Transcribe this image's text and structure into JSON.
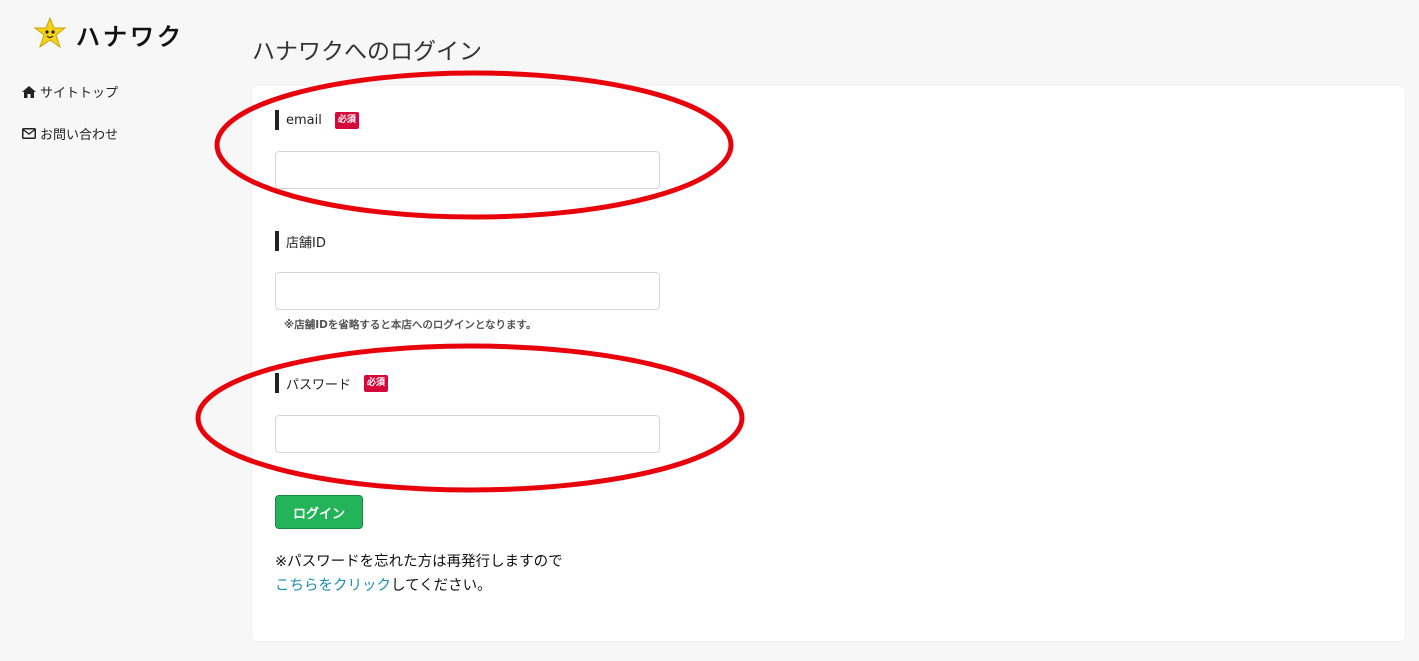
{
  "brand": {
    "name": "ハナワク",
    "logo_icon": "star-mascot-icon",
    "logo_color": "#f5d21a"
  },
  "sidebar": {
    "items": [
      {
        "icon": "home-icon",
        "label": "サイトトップ"
      },
      {
        "icon": "envelope-icon",
        "label": "お問い合わせ"
      }
    ]
  },
  "page": {
    "title": "ハナワクへのログイン"
  },
  "form": {
    "email": {
      "label": "email",
      "required_badge": "必須",
      "value": "",
      "placeholder": ""
    },
    "store_id": {
      "label": "店舗ID",
      "value": "",
      "placeholder": "",
      "hint": "※店舗IDを省略すると本店へのログインとなります。"
    },
    "password": {
      "label": "パスワード",
      "required_badge": "必須",
      "value": "",
      "placeholder": ""
    },
    "submit_label": "ログイン"
  },
  "note": {
    "line1": "※パスワードを忘れた方は再発行しますので",
    "link_text": "こちらをクリック",
    "line2_suffix": "してください。"
  },
  "colors": {
    "required_badge": "#d6083b",
    "login_button": "#23b45a",
    "link": "#1a8fb8",
    "annotation_ellipse": "#e8000b"
  }
}
